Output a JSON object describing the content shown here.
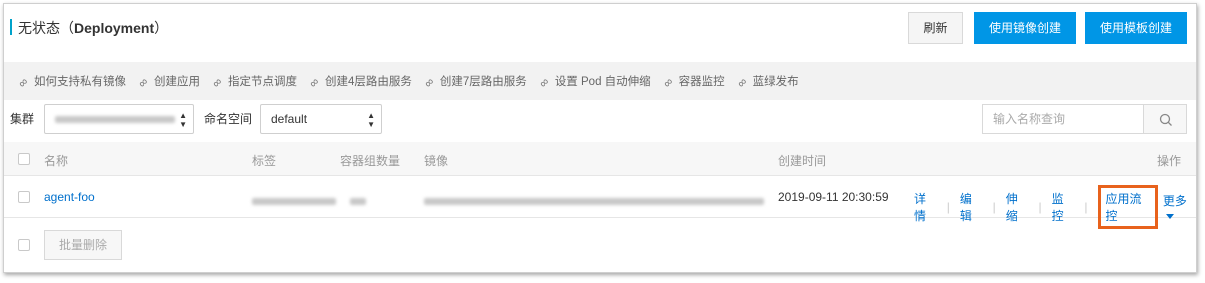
{
  "header": {
    "title_prefix": "无状态（",
    "title_bold": "Deployment",
    "title_suffix": "）",
    "refresh_label": "刷新",
    "create_from_image_label": "使用镜像创建",
    "create_from_template_label": "使用模板创建"
  },
  "help_links": [
    {
      "label": "如何支持私有镜像",
      "icon": "link-icon"
    },
    {
      "label": "创建应用",
      "icon": "link-icon"
    },
    {
      "label": "指定节点调度",
      "icon": "link-icon"
    },
    {
      "label": "创建4层路由服务",
      "icon": "link-icon"
    },
    {
      "label": "创建7层路由服务",
      "icon": "link-icon"
    },
    {
      "label": "设置 Pod 自动伸缩",
      "icon": "link-icon"
    },
    {
      "label": "容器监控",
      "icon": "link-icon"
    },
    {
      "label": "蓝绿发布",
      "icon": "link-icon"
    }
  ],
  "filter": {
    "cluster_label": "集群",
    "namespace_label": "命名空间",
    "namespace_value": "default",
    "search_placeholder": "输入名称查询"
  },
  "table": {
    "columns": {
      "name": "名称",
      "tags": "标签",
      "pod_count": "容器组数量",
      "image": "镜像",
      "created": "创建时间",
      "actions": "操作"
    },
    "rows": [
      {
        "name": "agent-foo",
        "created": "2019-09-11 20:30:59",
        "actions": [
          "详情",
          "编辑",
          "伸缩",
          "监控",
          "应用流控"
        ],
        "more_label": "更多"
      }
    ]
  },
  "footer": {
    "batch_delete_label": "批量删除"
  },
  "colors": {
    "primary": "#0096e6",
    "link": "#0070cc",
    "highlight": "#e8621c",
    "title_accent": "#00a2ca"
  }
}
